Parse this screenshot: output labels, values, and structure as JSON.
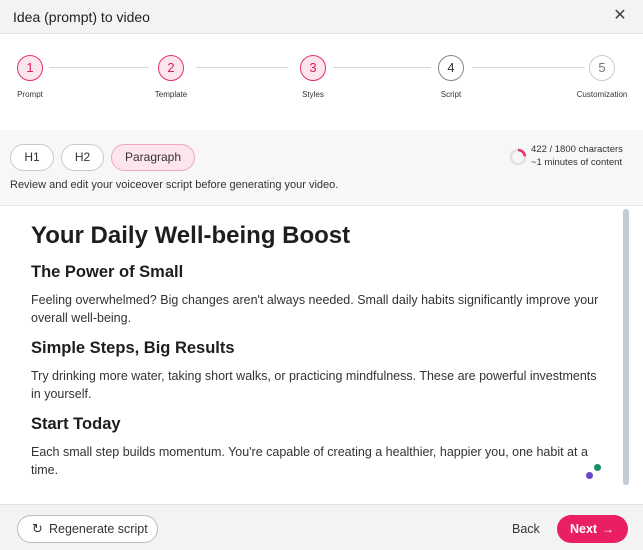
{
  "dialog": {
    "title": "Idea (prompt) to video",
    "close_icon": "close-icon"
  },
  "stepper": {
    "steps": [
      {
        "number": "1",
        "label": "Prompt",
        "state": "done"
      },
      {
        "number": "2",
        "label": "Template",
        "state": "done"
      },
      {
        "number": "3",
        "label": "Styles",
        "state": "done"
      },
      {
        "number": "4",
        "label": "Script",
        "state": "current"
      },
      {
        "number": "5",
        "label": "Customization",
        "state": "future"
      }
    ]
  },
  "toolbar": {
    "format_buttons": [
      "H1",
      "H2",
      "Paragraph"
    ],
    "active_format": "Paragraph",
    "characters": "422 / 1800 characters",
    "duration": "~1 minutes of content",
    "char_progress": 0.234,
    "hint": "Review and edit your voiceover script before generating your video."
  },
  "script": {
    "title": "Your Daily Well-being Boost",
    "sections": [
      {
        "heading": "The Power of Small",
        "body": "Feeling overwhelmed? Big changes aren't always needed. Small daily habits significantly improve your overall well-being."
      },
      {
        "heading": "Simple Steps, Big Results",
        "body": "Try drinking more water, taking short walks, or practicing mindfulness. These are powerful investments in yourself."
      },
      {
        "heading": "Start Today",
        "body": "Each small step builds momentum. You're capable of creating a healthier, happier you, one habit at a time."
      }
    ]
  },
  "footer": {
    "regenerate_label": "Regenerate script",
    "back_label": "Back",
    "next_label": "Next"
  },
  "colors": {
    "accent": "#e91e63",
    "step_done_bg": "#fde5ee",
    "step_done_border": "#e0336f",
    "active_format_bg": "#fde5ee"
  }
}
